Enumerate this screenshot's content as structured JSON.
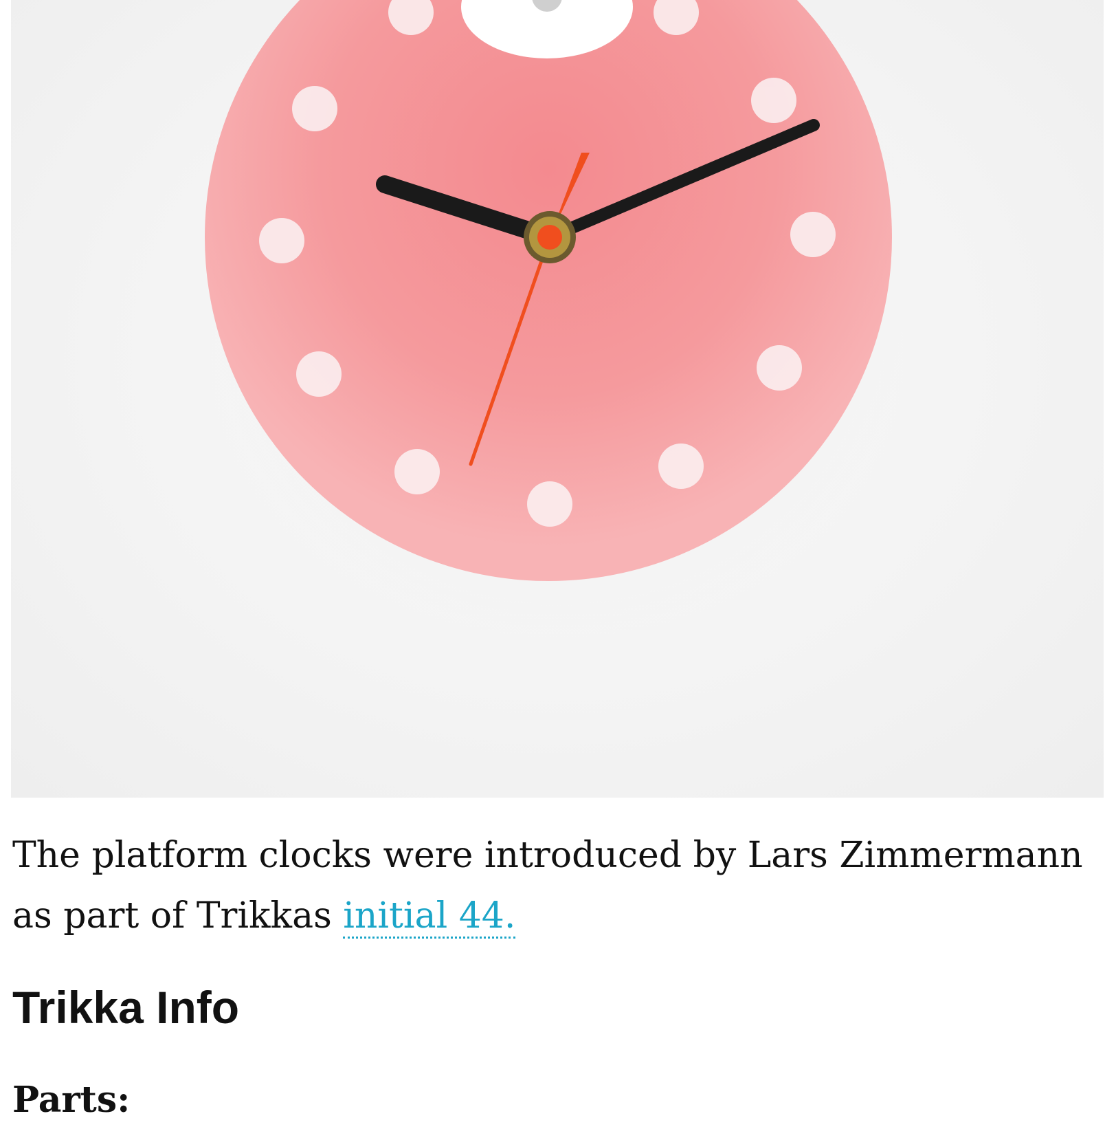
{
  "photo": {
    "subject": "pink-wall-clock-icon",
    "colors": {
      "dial": "#f7a3a6",
      "dial_inner": "#f48b90",
      "dots": "#fbeef0",
      "hands": "#1a1a1a",
      "second_hand": "#f04e1e",
      "background": "#f3f3f3"
    }
  },
  "caption": {
    "text_before_link": "The platform clocks were introduced by Lars Zimmermann as part of Trikkas ",
    "link_text": "initial 44."
  },
  "section": {
    "title": "Trikka Info",
    "parts_label": "Parts:"
  }
}
